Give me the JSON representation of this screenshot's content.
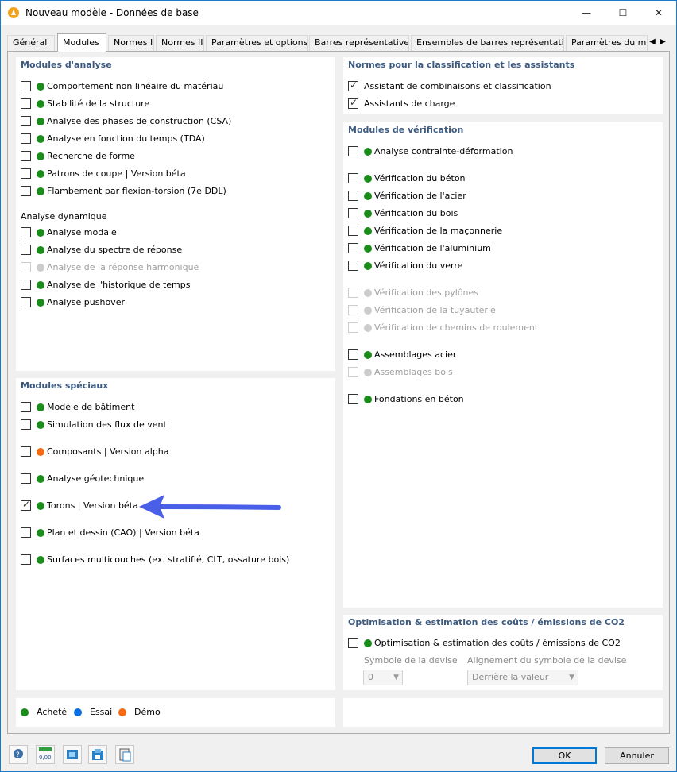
{
  "window": {
    "title": "Nouveau modèle - Données de base",
    "minimize": "—",
    "maximize": "☐",
    "close": "✕"
  },
  "tabs": [
    "Général",
    "Modules",
    "Normes I",
    "Normes II",
    "Paramètres et options",
    "Barres représentatives",
    "Ensembles de barres représentatifs",
    "Paramètres du modèle"
  ],
  "active_tab": "Modules",
  "colors": {
    "purchased": "#1a8c1a",
    "trial": "#0a6fe0",
    "demo": "#f56a12",
    "disabled": "#cccccc",
    "accent": "#3c5a80",
    "arrow": "#4a5fe8"
  },
  "analysis": {
    "title": "Modules d'analyse",
    "items": [
      {
        "label": "Comportement non linéaire du matériau",
        "checked": false,
        "status": "purchased"
      },
      {
        "label": "Stabilité de la structure",
        "checked": false,
        "status": "purchased"
      },
      {
        "label": "Analyse des phases de construction (CSA)",
        "checked": false,
        "status": "purchased"
      },
      {
        "label": "Analyse en fonction du temps (TDA)",
        "checked": false,
        "status": "purchased"
      },
      {
        "label": "Recherche de forme",
        "checked": false,
        "status": "purchased"
      },
      {
        "label": "Patrons de coupe | Version béta",
        "checked": false,
        "status": "purchased"
      },
      {
        "label": "Flambement par flexion-torsion (7e DDL)",
        "checked": false,
        "status": "purchased"
      }
    ],
    "dynamic_title": "Analyse dynamique",
    "dynamic_items": [
      {
        "label": "Analyse modale",
        "checked": false,
        "status": "purchased"
      },
      {
        "label": "Analyse du spectre de réponse",
        "checked": false,
        "status": "purchased"
      },
      {
        "label": "Analyse de la réponse harmonique",
        "checked": false,
        "status": "disabled"
      },
      {
        "label": "Analyse de l'historique de temps",
        "checked": false,
        "status": "purchased"
      },
      {
        "label": "Analyse pushover",
        "checked": false,
        "status": "purchased"
      }
    ]
  },
  "special": {
    "title": "Modules spéciaux",
    "items": [
      {
        "label": "Modèle de bâtiment",
        "checked": false,
        "status": "purchased"
      },
      {
        "label": "Simulation des flux de vent",
        "checked": false,
        "status": "purchased"
      },
      {
        "label": "Composants | Version alpha",
        "checked": false,
        "status": "demo"
      },
      {
        "label": "Analyse géotechnique",
        "checked": false,
        "status": "purchased"
      },
      {
        "label": "Torons | Version béta",
        "checked": true,
        "status": "purchased"
      },
      {
        "label": "Plan et dessin (CAO) | Version béta",
        "checked": false,
        "status": "purchased"
      },
      {
        "label": "Surfaces multicouches (ex. stratifié, CLT, ossature bois)",
        "checked": false,
        "status": "purchased"
      }
    ]
  },
  "norms": {
    "title": "Normes pour la classification et les assistants",
    "items": [
      {
        "label": "Assistant de combinaisons et classification",
        "checked": true
      },
      {
        "label": "Assistants de charge",
        "checked": true
      }
    ]
  },
  "verification": {
    "title": "Modules de vérification",
    "items": [
      {
        "label": "Analyse contrainte-déformation",
        "checked": false,
        "status": "purchased"
      },
      {
        "label": "Vérification du béton",
        "checked": false,
        "status": "purchased"
      },
      {
        "label": "Vérification de l'acier",
        "checked": false,
        "status": "purchased"
      },
      {
        "label": "Vérification du bois",
        "checked": false,
        "status": "purchased"
      },
      {
        "label": "Vérification de la maçonnerie",
        "checked": false,
        "status": "purchased"
      },
      {
        "label": "Vérification de l'aluminium",
        "checked": false,
        "status": "purchased"
      },
      {
        "label": "Vérification du verre",
        "checked": false,
        "status": "purchased"
      },
      {
        "label": "Vérification des pylônes",
        "checked": false,
        "status": "disabled"
      },
      {
        "label": "Vérification de la tuyauterie",
        "checked": false,
        "status": "disabled"
      },
      {
        "label": "Vérification de chemins de roulement",
        "checked": false,
        "status": "disabled"
      },
      {
        "label": "Assemblages acier",
        "checked": false,
        "status": "purchased"
      },
      {
        "label": "Assemblages bois",
        "checked": false,
        "status": "disabled"
      },
      {
        "label": "Fondations en béton",
        "checked": false,
        "status": "purchased"
      }
    ]
  },
  "optimization": {
    "title": "Optimisation & estimation des coûts / émissions de CO2",
    "item": {
      "label": "Optimisation & estimation des coûts / émissions de CO2",
      "checked": false,
      "status": "purchased"
    },
    "currency_label": "Symbole de la devise",
    "currency_value": "0",
    "align_label": "Alignement du symbole de la devise",
    "align_value": "Derrière la valeur"
  },
  "legend": {
    "purchased": "Acheté",
    "trial": "Essai",
    "demo": "Démo"
  },
  "toolbar_icons": [
    "help-icon",
    "units-icon",
    "model-import-icon",
    "save-template-icon",
    "clipboard-icon"
  ],
  "units_icon_text": "0,00",
  "buttons": {
    "ok": "OK",
    "cancel": "Annuler"
  }
}
